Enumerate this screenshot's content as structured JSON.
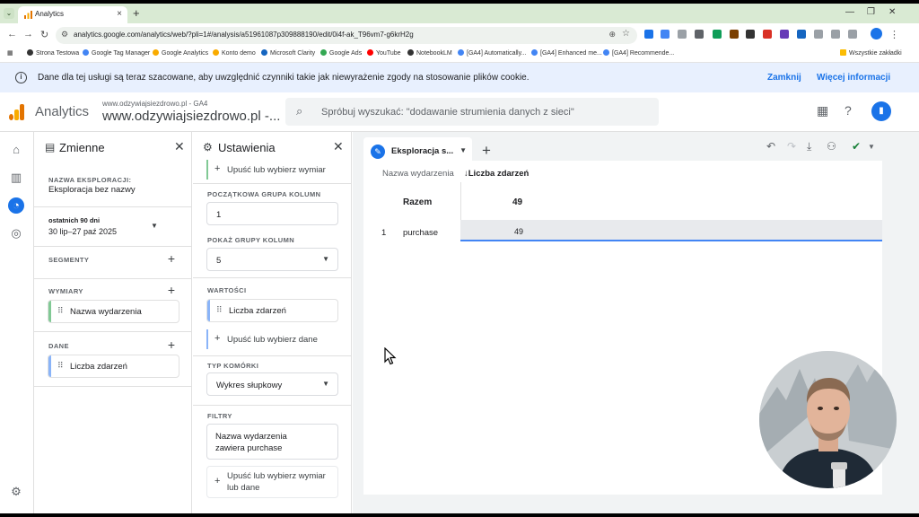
{
  "browser": {
    "tab_title": "Analytics",
    "url": "analytics.google.com/analytics/web/?pli=1#/analysis/a51961087p309888190/edit/0i4f-ak_T96vm7-g6krH2g",
    "bookmarks": [
      "Strona Testowa",
      "Google Tag Manager",
      "Google Analytics",
      "Konto demo",
      "Microsoft Clarity",
      "Google Ads",
      "YouTube",
      "NotebookLM",
      "[GA4] Automatically...",
      "[GA4] Enhanced me...",
      "[GA4] Recommende..."
    ],
    "all_bookmarks": "Wszystkie zakładki"
  },
  "banner": {
    "message": "Dane dla tej usługi są teraz szacowane, aby uwzględnić czynniki takie jak niewyrażenie zgody na stosowanie plików cookie.",
    "close": "Zamknij",
    "more": "Więcej informacji"
  },
  "header": {
    "app": "Analytics",
    "property_sub": "www.odzywiajsiezdrowo.pl - GA4",
    "property": "www.odzywiajsiezdrowo.pl -...",
    "search_placeholder": "Spróbuj wyszukać: \"dodawanie strumienia danych z sieci\""
  },
  "variables": {
    "title": "Zmienne",
    "exploration_label": "NAZWA EKSPLORACJI:",
    "exploration_name": "Eksploracja bez nazwy",
    "range_label": "ostatnich 90 dni",
    "range_value": "30 lip–27 paź 2025",
    "segments": "SEGMENTY",
    "dimensions": "WYMIARY",
    "dimension_item": "Nazwa wydarzenia",
    "metrics": "DANE",
    "metric_item": "Liczba zdarzeń"
  },
  "settings": {
    "title": "Ustawienia",
    "drop_dimension": "Upuść lub wybierz wymiar",
    "start_group_label": "POCZĄTKOWA GRUPA KOLUMN",
    "start_group_value": "1",
    "show_groups_label": "POKAŻ GRUPY KOLUMN",
    "show_groups_value": "5",
    "values_label": "WARTOŚCI",
    "values_item": "Liczba zdarzeń",
    "drop_data": "Upuść lub wybierz dane",
    "cell_type_label": "TYP KOMÓRKI",
    "cell_type_value": "Wykres słupkowy",
    "filters_label": "FILTRY",
    "filter_line1": "Nazwa wydarzenia",
    "filter_line2": "zawiera purchase",
    "drop_any_line1": "Upuść lub wybierz wymiar",
    "drop_any_line2": "lub dane"
  },
  "canvas": {
    "tab_label": "Eksploracja s...",
    "col_dimension": "Nazwa wydarzenia",
    "col_metric": "↓Liczba zdarzeń",
    "total_label": "Razem",
    "total_value": "49",
    "row_index": "1",
    "row_name": "purchase",
    "row_value": "49"
  },
  "colors": {
    "accent": "#1a73e8",
    "dim_bar": "#81c995",
    "metric_bar": "#8ab4f8"
  }
}
